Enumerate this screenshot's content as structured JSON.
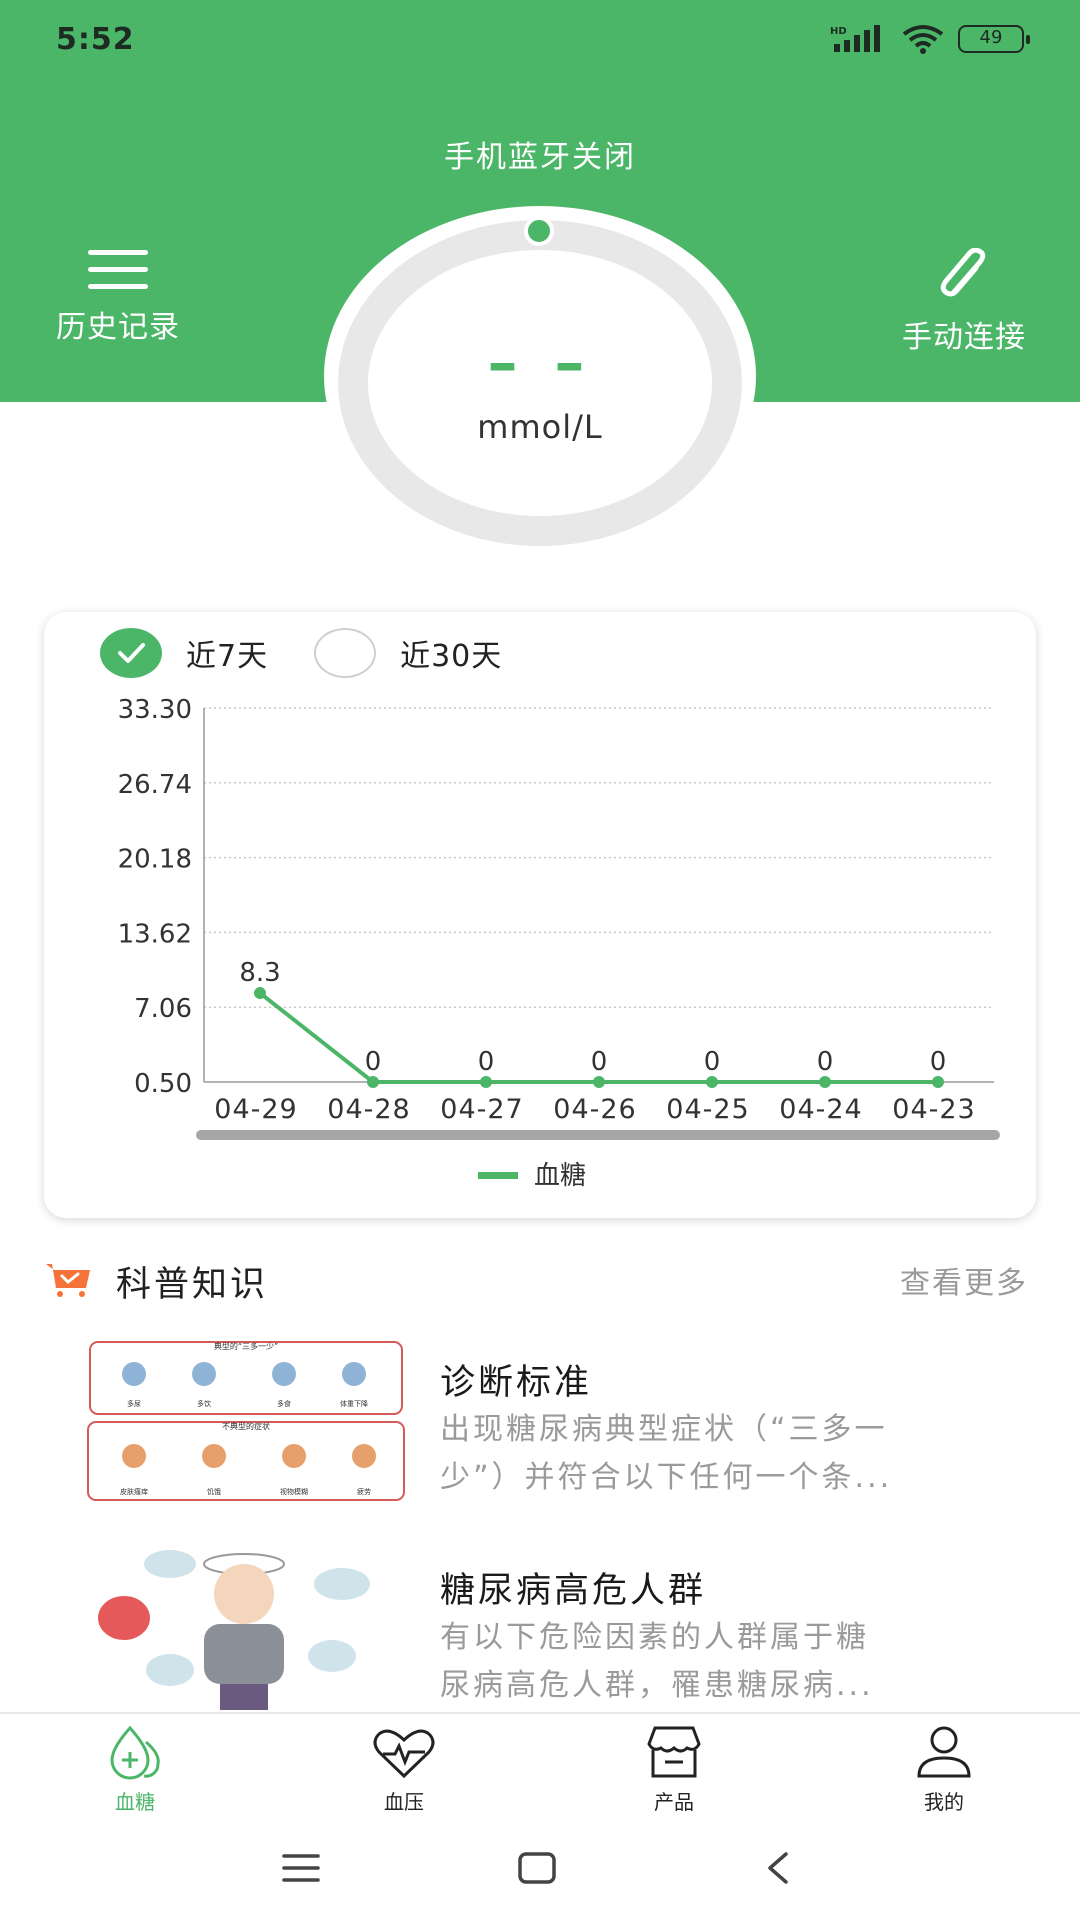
{
  "status_bar": {
    "time": "5:52",
    "network": "HD",
    "battery": "49",
    "icons": [
      "signal-icon",
      "wifi-icon",
      "battery-icon"
    ]
  },
  "header": {
    "bluetooth_status": "手机蓝牙关闭",
    "history_label": "历史记录",
    "connect_label": "手动连接",
    "accent_color": "#4cb668"
  },
  "gauge": {
    "value": "– –",
    "unit": "mmol/L"
  },
  "range_toggle": [
    {
      "label": "近7天",
      "selected": true
    },
    {
      "label": "近30天",
      "selected": false
    }
  ],
  "chart_data": {
    "type": "line",
    "categories": [
      "04-29",
      "04-28",
      "04-27",
      "04-26",
      "04-25",
      "04-24",
      "04-23"
    ],
    "series": [
      {
        "name": "血糖",
        "values": [
          8.3,
          0,
          0,
          0,
          0,
          0,
          0
        ],
        "color": "#4cb668"
      }
    ],
    "data_labels": [
      "8.3",
      "0",
      "0",
      "0",
      "0",
      "0",
      "0"
    ],
    "y_ticks": [
      "33.30",
      "26.74",
      "20.18",
      "13.62",
      "7.06",
      "0.50"
    ],
    "ylim": [
      0.5,
      33.3
    ],
    "grid": true,
    "legend_position": "bottom-center"
  },
  "science": {
    "title": "科普知识",
    "more_label": "查看更多",
    "articles": [
      {
        "title": "诊断标准",
        "desc_line1": "出现糖尿病典型症状（“三多一",
        "desc_line2": "少”）并符合以下任何一个条..."
      },
      {
        "title": "糖尿病高危人群",
        "desc_line1": "有以下危险因素的人群属于糖",
        "desc_line2": "尿病高危人群，罹患糖尿病..."
      }
    ],
    "thumb_texts": {
      "diagnosis_header": "典型的“三多一少”",
      "diagnosis_sub": "不典型的症状",
      "diagnosis_top": [
        "多尿",
        "多饮",
        "多食",
        "体重下降"
      ],
      "diagnosis_bottom": [
        "皮肤瘙痒",
        "饥饿",
        "视物模糊",
        "疲劳"
      ]
    }
  },
  "tab_bar": [
    {
      "label": "血糖",
      "icon": "blood-drop-icon",
      "active": true
    },
    {
      "label": "血压",
      "icon": "heart-pulse-icon",
      "active": false
    },
    {
      "label": "产品",
      "icon": "store-icon",
      "active": false
    },
    {
      "label": "我的",
      "icon": "user-icon",
      "active": false
    }
  ],
  "nav_bar": [
    "menu-icon",
    "home-icon",
    "back-icon"
  ]
}
